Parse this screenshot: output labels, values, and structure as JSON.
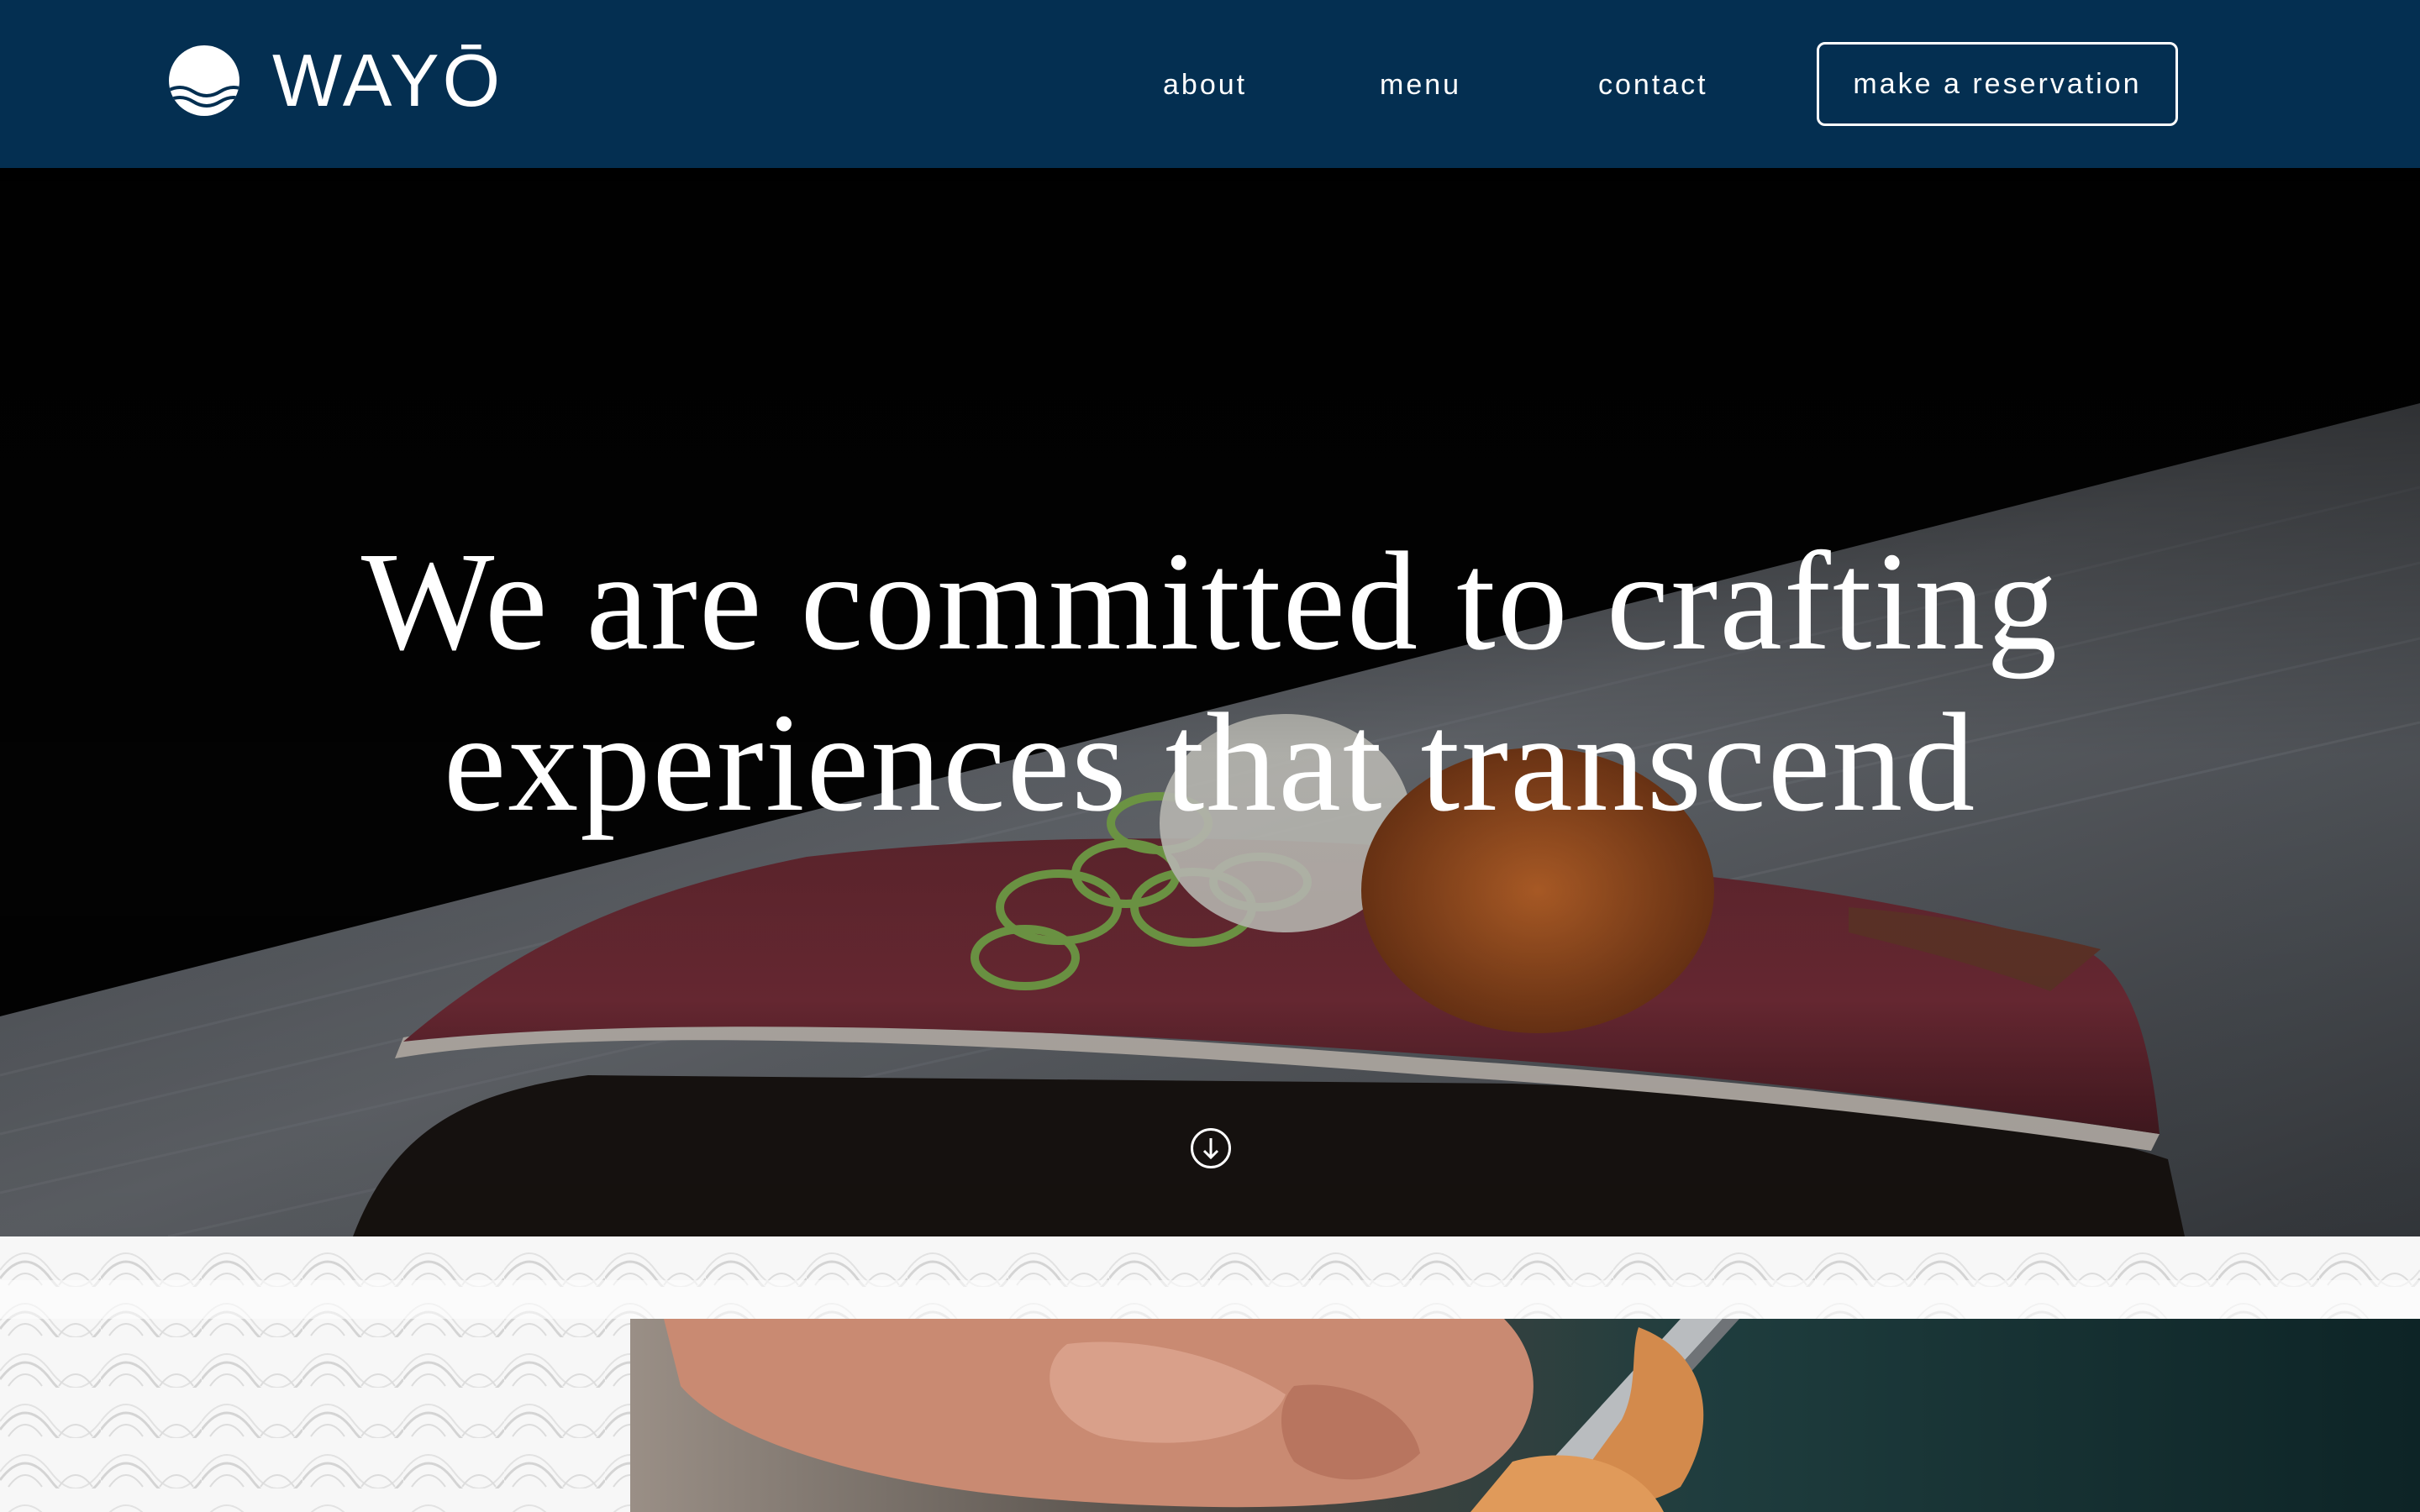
{
  "header": {
    "logo_text": "WAYŌ",
    "logo_icon": "sun-over-waves-icon",
    "nav": {
      "about": "about",
      "menu": "menu",
      "contact": "contact"
    },
    "reservation_label": "make a reservation"
  },
  "hero": {
    "title_line1": "We are committed to crafting",
    "title_line2": "experiences that transcend",
    "scroll_icon": "arrow-down-circle-icon"
  },
  "colors": {
    "header_bg": "#042f51",
    "text": "#ffffff"
  }
}
